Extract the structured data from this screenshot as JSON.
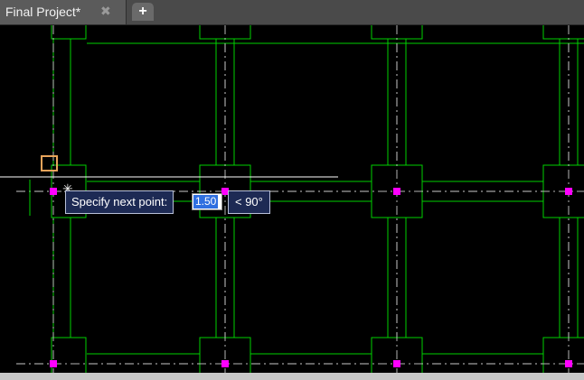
{
  "tabs": [
    {
      "label": "Final Project*",
      "close_glyph": "✖",
      "active": true
    }
  ],
  "new_tab": {
    "glyph": "+"
  },
  "dynamic_input": {
    "prompt": "Specify next point:",
    "value": "1.50",
    "angle": "< 90°"
  },
  "cursor": {
    "glyph": "✳"
  },
  "colors": {
    "background": "#000000",
    "structure": "#00d000",
    "grid_axis": "#c8c8c8",
    "grip": "#ff00ff",
    "snap_marker": "#e8a35a",
    "tooltip_bg": "#1d2a54",
    "selection": "#2f6fe0"
  },
  "icons": {
    "tab_close": "close-icon",
    "new_tab": "plus-icon",
    "snap": "endpoint-snap-icon",
    "cursor": "crosshair-icon"
  }
}
